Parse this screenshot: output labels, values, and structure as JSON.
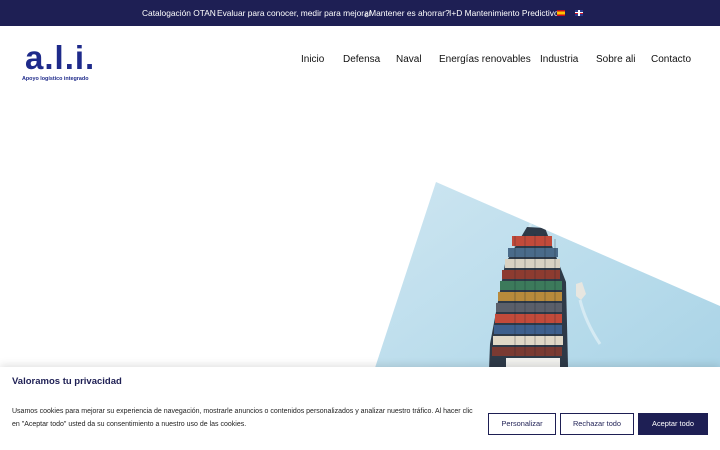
{
  "topbar": {
    "links": [
      "Catalogación OTAN",
      "Evaluar para conocer, medir para mejorar",
      "¿Mantener es ahorrar?",
      "I+D Mantenimiento Predictivo"
    ],
    "flags": [
      "spanish-flag-icon",
      "english-flag-icon"
    ],
    "background": "#1e1f54"
  },
  "logo": {
    "main": "a.l.i.",
    "sub": "Apoyo logístico integrado",
    "color": "#1e2a8a"
  },
  "nav": {
    "items": [
      "Inicio",
      "Defensa",
      "Naval",
      "Energías renovables",
      "Industria",
      "Sobre ali",
      "Contacto"
    ]
  },
  "hero": {
    "image": "container-ship-aerial-photo"
  },
  "cookie": {
    "title": "Valoramos tu privacidad",
    "text": "Usamos cookies para mejorar su experiencia de navegación, mostrarle anuncios o contenidos personalizados y analizar nuestro tráfico. Al hacer clic en \"Aceptar todo\" usted da su consentimiento a nuestro uso de las cookies.",
    "customize_label": "Personalizar",
    "reject_label": "Rechazar todo",
    "accept_label": "Aceptar todo",
    "accent": "#1e1f54"
  }
}
